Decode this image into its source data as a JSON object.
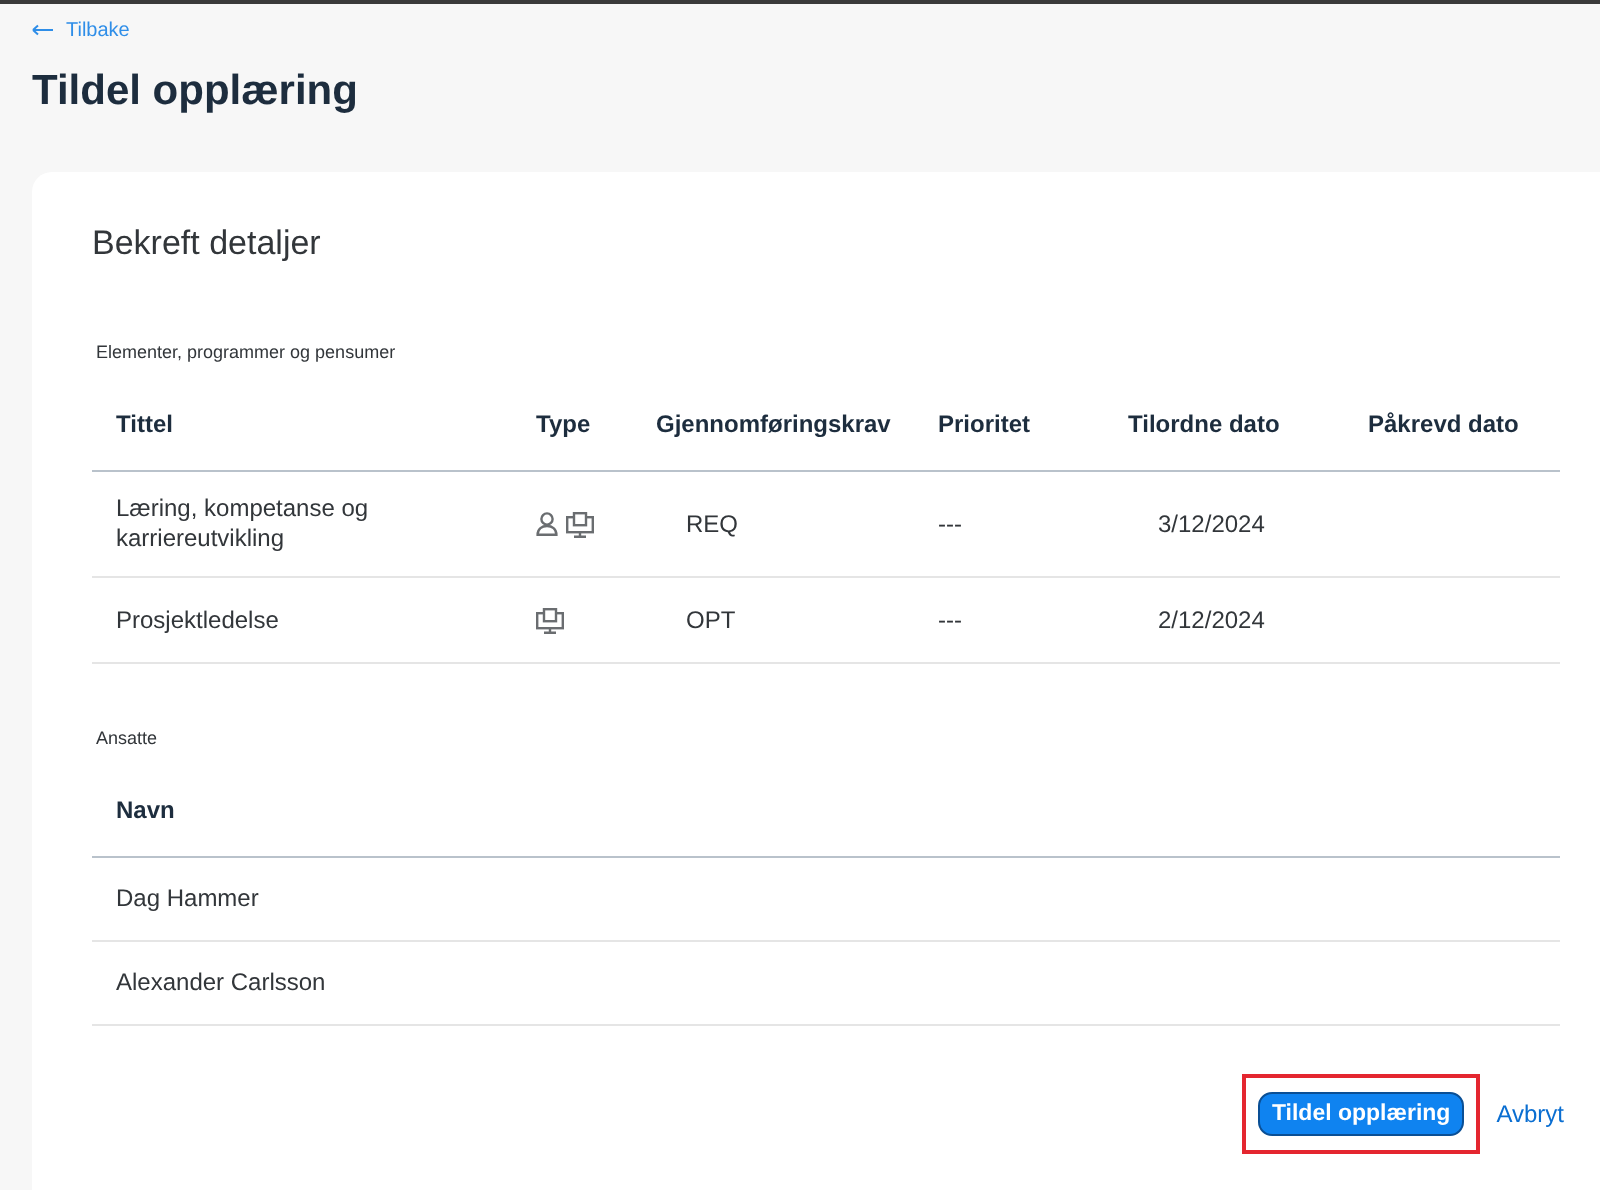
{
  "back_link": {
    "label": "Tilbake"
  },
  "page_title": "Tildel opplæring",
  "card_title": "Bekreft detaljer",
  "items_section": {
    "caption": "Elementer, programmer og pensumer",
    "columns": [
      "Tittel",
      "Type",
      "Gjennomføringskrav",
      "Prioritet",
      "Tilordne dato",
      "Påkrevd dato"
    ],
    "rows": [
      {
        "title": "Læring, kompetanse og karriereutvikling",
        "types": [
          {
            "kind": "person"
          },
          {
            "kind": "computer"
          }
        ],
        "requirement": "REQ",
        "priority": "---",
        "assign_date": "3/12/2024"
      },
      {
        "title": "Prosjektledelse",
        "types": [
          {
            "kind": "computer"
          }
        ],
        "requirement": "OPT",
        "priority": "---",
        "assign_date": "2/12/2024"
      }
    ]
  },
  "employees_section": {
    "caption": "Ansatte",
    "columns": [
      "Navn"
    ],
    "rows": [
      "Dag Hammer",
      "Alexander Carlsson"
    ]
  },
  "buttons": [
    {
      "label": "Tildel opplæring",
      "kind": "primary",
      "highlighted": true
    },
    {
      "label": "Avbryt",
      "kind": "link",
      "highlighted": false
    }
  ]
}
